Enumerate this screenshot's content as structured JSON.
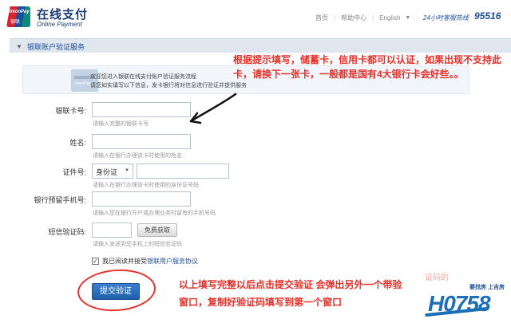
{
  "header": {
    "logo_text": "UnionPay",
    "logo_text_cn": "银联",
    "brand_cn": "在线支付",
    "brand_en": "Online Payment",
    "nav": {
      "home": "首页",
      "help": "帮助中心",
      "language": "English"
    },
    "hotline_label": "24小时客服热线",
    "hotline_number": "95516"
  },
  "section": {
    "title": "银联账户验证服务"
  },
  "intro": {
    "line1": "欢迎您进入银联在线支付账户验证服务流程",
    "line2": "请您如实填写以下信息，发卡银行将对信息进行验证并提供服务",
    "icon_text": "UnionPay"
  },
  "form": {
    "card_number": {
      "label": "银联卡号:",
      "value": "",
      "hint": "请输入完整的银联卡号"
    },
    "name": {
      "label": "姓名:",
      "value": "",
      "hint": "请输入在银行办理该卡时使用的姓名"
    },
    "id_number": {
      "label": "证件号:",
      "type_selected": "身份证",
      "value": "",
      "hint": "请输入在银行办理该卡时使用的身份证号码"
    },
    "phone": {
      "label": "银行预留手机号:",
      "value": "",
      "hint": "请输入您在银行开户或办理业务时留有的手机号码"
    },
    "sms": {
      "label": "短信验证码:",
      "value": "",
      "button_label": "免费获取",
      "hint": "请输入发送到您手机上的短信验证码"
    },
    "agreement": {
      "checked": true,
      "check_mark": "✓",
      "text": "我已阅读并接受",
      "link": "银联用户服务协议"
    },
    "submit_label": "提交验证"
  },
  "annotations": {
    "top_note": "根据提示填写，储蓄卡，信用卡都可以认证，如果出现不支持此卡，请换下一张卡，一般都是国有4大银行卡会好些。。",
    "bottom_note_line1": "以上填写完整以后点击提交验证 会弹出另外一个带验",
    "bottom_note_line2": "窗口，复制好验证码填写到第一个窗口",
    "annotation_color": "#e8302a"
  },
  "watermark": {
    "tagline": "要找房 上吉房",
    "number": "H0758",
    "faint_overlay": "证码的"
  },
  "colors": {
    "brand_blue": "#1c4e9b",
    "unionpay_red": "#d9232e",
    "unionpay_blue": "#1c4e9b",
    "unionpay_green": "#0a8a7a",
    "annotation_red": "#e8302a",
    "section_bar_bg": "#dfe6ee"
  },
  "icons": {
    "language_dropdown": "chevron-down-icon",
    "section_toggle": "triangle-down-icon",
    "select_dropdown": "chevron-down-icon"
  }
}
